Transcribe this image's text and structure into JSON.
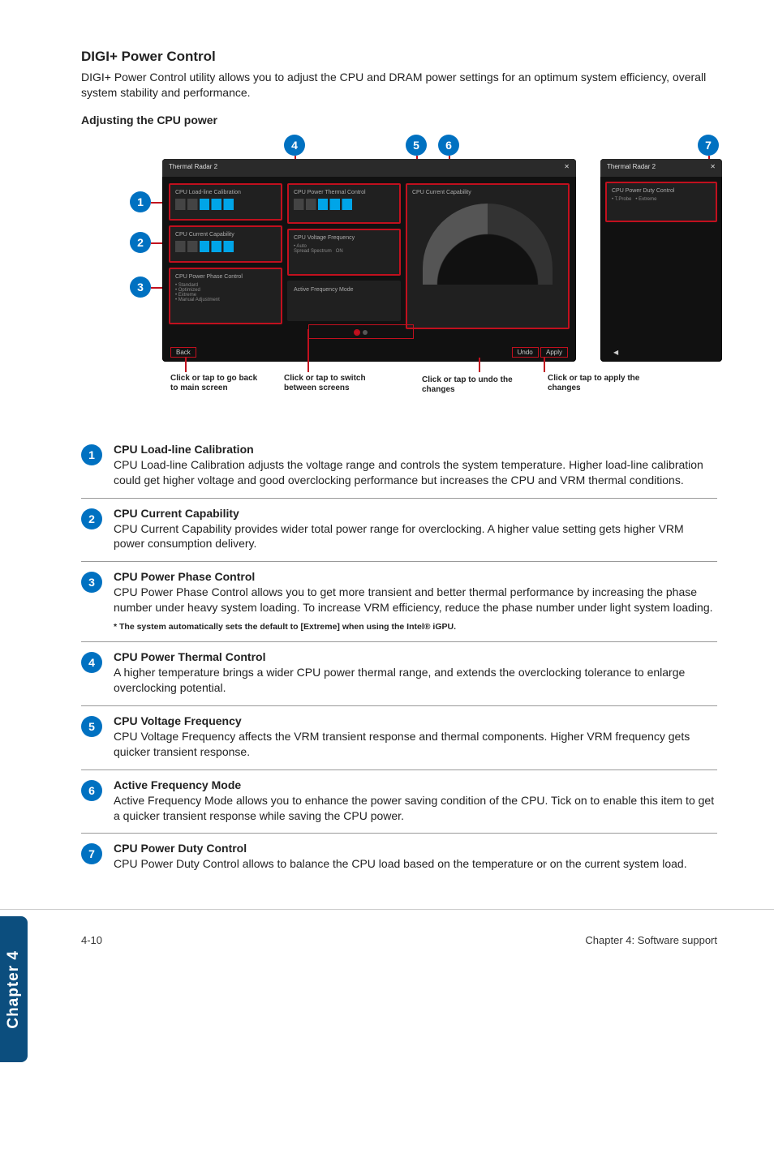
{
  "section": {
    "title": "DIGI+ Power Control",
    "intro": "DIGI+ Power Control utility allows you to adjust the CPU and DRAM power settings for an optimum system efficiency, overall system stability and performance.",
    "subTitle": "Adjusting the CPU power"
  },
  "diagram": {
    "ssBigTitle": "Thermal Radar 2",
    "ssSmallTitle": "Thermal Radar 2",
    "panels": {
      "loadline": "CPU Load-line Calibration",
      "currentCap": "CPU Current Capability",
      "phase": "CPU Power Phase Control",
      "thermal": "CPU Power Thermal Control",
      "voltfreq": "CPU Voltage Frequency",
      "activefreq": "Active Frequency Mode",
      "currentCapGauge": "CPU Current Capability",
      "duty": "CPU Power Duty Control"
    },
    "footerLeft": "Back",
    "footerUndo": "Undo",
    "footerApply": "Apply",
    "captionBack": "Click or tap to go back to main screen",
    "captionSwitch": "Click or tap to switch between screens",
    "captionUndo": "Click or tap to undo the changes",
    "captionApply": "Click or tap to apply the changes"
  },
  "bubbles": {
    "b1": "1",
    "b2": "2",
    "b3": "3",
    "b4": "4",
    "b5": "5",
    "b6": "6",
    "b7": "7"
  },
  "features": {
    "f1": {
      "num": "1",
      "title": "CPU Load-line Calibration",
      "body": "CPU Load-line Calibration adjusts the voltage range and controls the system temperature. Higher load-line calibration could get higher voltage and good overclocking performance but increases the CPU and VRM thermal conditions."
    },
    "f2": {
      "num": "2",
      "title": "CPU Current Capability",
      "body": "CPU Current Capability provides wider total power range for overclocking. A higher value setting gets higher VRM power consumption delivery."
    },
    "f3": {
      "num": "3",
      "title": "CPU Power Phase Control",
      "body": "CPU Power Phase Control allows you to get more transient and better thermal performance by increasing the phase number under heavy system loading. To increase VRM efficiency, reduce the phase number under light system loading.",
      "note": "* The system automatically sets the default to [Extreme] when using the Intel® iGPU."
    },
    "f4": {
      "num": "4",
      "title": "CPU Power Thermal Control",
      "body": "A higher temperature brings a wider CPU power thermal range, and extends the overclocking tolerance to enlarge overclocking potential."
    },
    "f5": {
      "num": "5",
      "title": "CPU Voltage Frequency",
      "body": "CPU Voltage Frequency affects the VRM transient response and thermal components. Higher VRM frequency gets quicker transient response."
    },
    "f6": {
      "num": "6",
      "title": "Active Frequency Mode",
      "body": "Active Frequency Mode allows you to enhance the power saving condition of the CPU. Tick on to enable this item to get a quicker transient response while saving the CPU power."
    },
    "f7": {
      "num": "7",
      "title": "CPU Power Duty Control",
      "body": "CPU Power Duty Control allows to balance the CPU load based on the temperature or on the current system load."
    }
  },
  "sideTab": "Chapter 4",
  "footer": {
    "left": "4-10",
    "right": "Chapter 4: Software support"
  }
}
